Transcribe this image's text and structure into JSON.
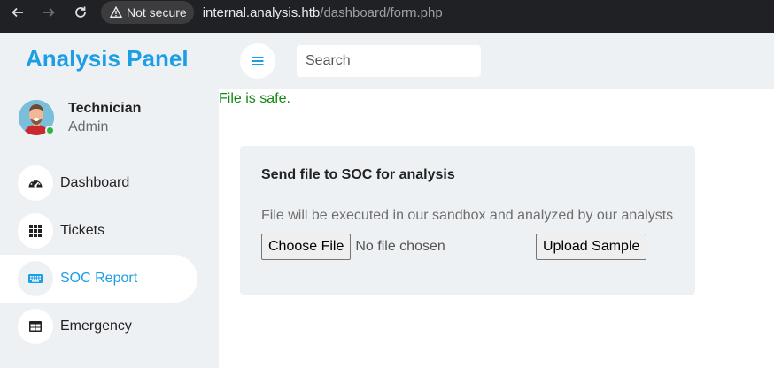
{
  "browser": {
    "security_label": "Not secure",
    "url_host": "internal.analysis.htb",
    "url_path": "/dashboard/form.php"
  },
  "sidebar": {
    "brand": "Analysis Panel",
    "user": {
      "name": "Technician",
      "role": "Admin",
      "status": "online"
    },
    "items": [
      {
        "label": "Dashboard",
        "icon": "speedometer-icon",
        "active": false
      },
      {
        "label": "Tickets",
        "icon": "grid-icon",
        "active": false
      },
      {
        "label": "SOC Report",
        "icon": "keyboard-icon",
        "active": true
      },
      {
        "label": "Emergency",
        "icon": "table-icon",
        "active": false
      }
    ]
  },
  "topbar": {
    "search_placeholder": "Search"
  },
  "main": {
    "result_message": "File is safe.",
    "card": {
      "title": "Send file to SOC for analysis",
      "description": "File will be executed in our sandbox and analyzed by our analysts",
      "choose_button": "Choose File",
      "file_status": "No file chosen",
      "upload_button": "Upload Sample"
    }
  },
  "colors": {
    "accent": "#1c9ee6",
    "success": "#118811",
    "panel_bg": "#eef1f4"
  }
}
